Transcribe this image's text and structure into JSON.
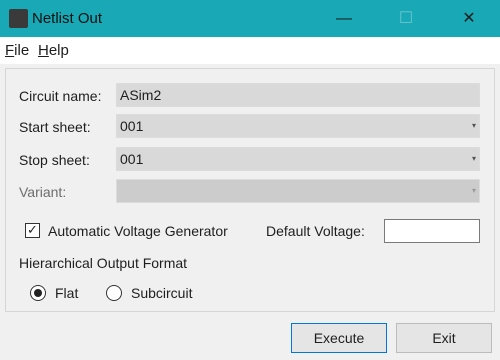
{
  "window": {
    "title": "Netlist Out",
    "minimize_glyph": "—",
    "maximize_glyph": "☐",
    "close_glyph": "✕",
    "accent_color": "#19a8b5"
  },
  "menu": {
    "file": {
      "mnemonic": "F",
      "rest": "ile"
    },
    "help": {
      "mnemonic": "H",
      "rest": "elp"
    }
  },
  "form": {
    "circuit_name_label": "Circuit name:",
    "circuit_name_value": "ASim2",
    "start_sheet_label": "Start sheet:",
    "start_sheet_value": "001",
    "stop_sheet_label": "Stop sheet:",
    "stop_sheet_value": "001",
    "variant_label": "Variant:",
    "variant_value": "",
    "auto_voltage_label": "Automatic Voltage Generator",
    "auto_voltage_checked": true,
    "check_glyph": "✓",
    "default_voltage_label": "Default Voltage:",
    "default_voltage_value": "",
    "hier_format_label": "Hierarchical Output Format",
    "option_flat": "Flat",
    "option_subcircuit": "Subcircuit",
    "selected_option": "Flat",
    "dropdown_glyph": "▾"
  },
  "buttons": {
    "execute": "Execute",
    "exit": "Exit"
  }
}
